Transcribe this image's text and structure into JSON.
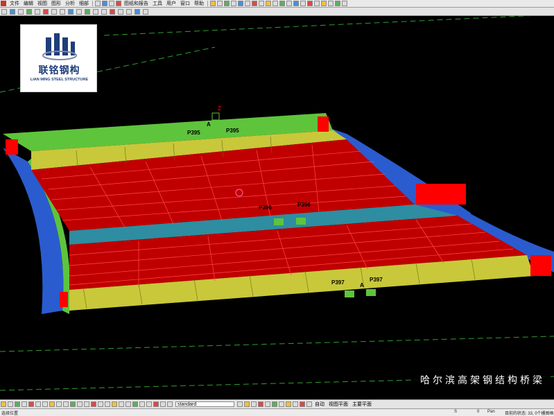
{
  "menubar": {
    "items": [
      "文件",
      "编辑",
      "视图",
      "图形",
      "分析",
      "细部",
      "图纸和报告",
      "工具",
      "用户",
      "窗口",
      "帮助"
    ]
  },
  "logo": {
    "name_cn": "联铭钢构",
    "name_en": "LIAN MING STEEL STRUCTURE"
  },
  "model": {
    "labels": {
      "p395_left": "P395",
      "p395_right": "P395",
      "p396_left": "P396",
      "p396_right": "P396",
      "p397_left": "P397",
      "p397_right": "P397",
      "axis_a_top": "A",
      "axis_a_bottom": "A",
      "axis_z": "Z"
    },
    "colors": {
      "deck_red": "#c00000",
      "deck_line": "#ff4a4a",
      "web_yellow": "#c8c83a",
      "top_green": "#5ec43c",
      "side_blue": "#2a5ccf",
      "middle_teal": "#2e8da0",
      "end_red": "#ff0000",
      "grid_green": "#3fae3f"
    }
  },
  "caption": "哈尔滨高架钢结构桥梁",
  "bottom_toolbar": {
    "input_value": "standard",
    "dropdowns": [
      "自动",
      "视图平面",
      "主要平面"
    ]
  },
  "statusbar": {
    "left": "选择位置",
    "mid1": "S",
    "mid2": "0",
    "mid3": "Pan",
    "right": "目前的状态: 33, 0个栅图框"
  }
}
